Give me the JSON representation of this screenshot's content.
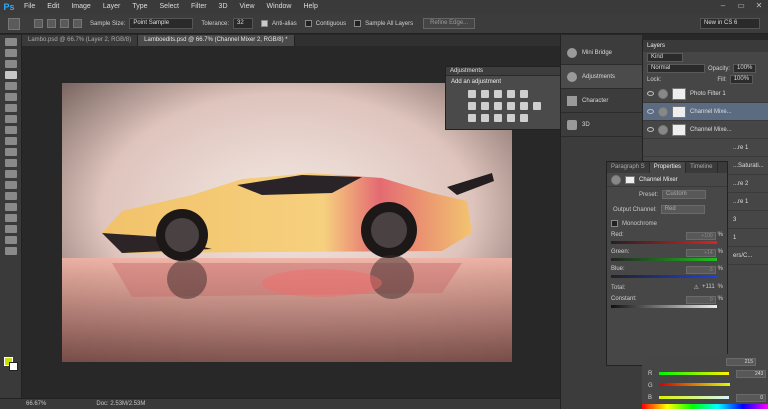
{
  "app": {
    "logo": "Ps"
  },
  "menu": [
    "File",
    "Edit",
    "Image",
    "Layer",
    "Type",
    "Select",
    "Filter",
    "3D",
    "View",
    "Window",
    "Help"
  ],
  "window_controls": [
    "–",
    "▭",
    "✕"
  ],
  "options": {
    "sample_size_label": "Sample Size:",
    "sample_size_value": "Point Sample",
    "tolerance_label": "Tolerance:",
    "tolerance_value": "32",
    "anti_alias_label": "Anti-alias",
    "contiguous_label": "Contiguous",
    "sample_all_layers_label": "Sample All Layers",
    "refine_edge_label": "Refine Edge...",
    "workspace_value": "New in CS 6"
  },
  "tabs": [
    {
      "label": "Lambo.psd @ 66.7% (Layer 2, RGB/8)"
    },
    {
      "label": "Lamboedits.psd @ 66.7% (Channel Mixer 2, RGB/8) *"
    }
  ],
  "status": {
    "zoom": "66.67%",
    "doc": "Doc: 2.53M/2.53M"
  },
  "dock": [
    {
      "label": "Mini Bridge"
    },
    {
      "label": "Adjustments"
    },
    {
      "label": "Character"
    },
    {
      "label": "3D"
    }
  ],
  "adjustments": {
    "title": "Adjustments",
    "subtitle": "Add an adjustment"
  },
  "layers": {
    "tab": "Layers",
    "kind": "Kind",
    "blend_mode": "Normal",
    "opacity_label": "Opacity:",
    "opacity": "100%",
    "lock_label": "Lock:",
    "fill_label": "Fill:",
    "fill": "100%",
    "items": [
      {
        "name": "Photo Filter 1"
      },
      {
        "name": "Channel Mixe..."
      },
      {
        "name": "Channel Mixe..."
      },
      {
        "name": "...re 1"
      },
      {
        "name": "...Saturati..."
      },
      {
        "name": "...re 2"
      },
      {
        "name": "...re 1"
      },
      {
        "name": "3"
      },
      {
        "name": "1"
      },
      {
        "name": "ers/C..."
      }
    ]
  },
  "properties": {
    "tabs": [
      "Paragraph S",
      "Properties",
      "Timeline"
    ],
    "header": "Channel Mixer",
    "preset_label": "Preset:",
    "preset_value": "Custom",
    "output_label": "Output Channel:",
    "output_value": "Red",
    "monochrome_label": "Monochrome",
    "red_label": "Red:",
    "red_value": "+100",
    "green_label": "Green:",
    "green_value": "+14",
    "blue_label": "Blue:",
    "blue_value": "-3",
    "pct": "%",
    "total_label": "Total:",
    "total_value": "+111",
    "constant_label": "Constant:",
    "constant_value": "0"
  },
  "color": {
    "r": "215",
    "g": "243",
    "b": "0",
    "r_label": "R",
    "g_label": "G",
    "b_label": "B"
  }
}
